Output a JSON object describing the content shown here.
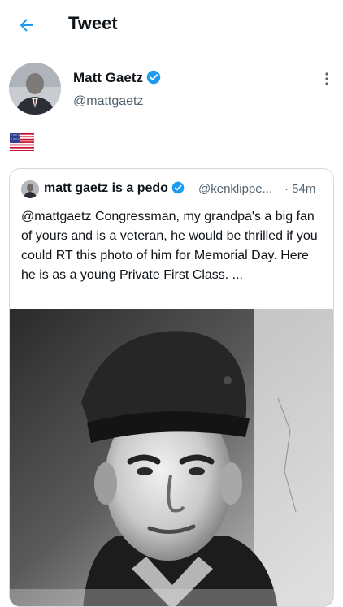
{
  "header": {
    "title": "Tweet"
  },
  "tweet": {
    "author_name": "Matt Gaetz",
    "author_handle": "@mattgaetz",
    "verified": true,
    "flag_icon": "us-flag-icon"
  },
  "quoted_tweet": {
    "author_name": "matt gaetz is a pedo",
    "verified": true,
    "author_handle": "@kenklippe...",
    "time": "· 54m",
    "text": "@mattgaetz Congressman, my grandpa's a big fan of yours and is a veteran, he would be thrilled if you could RT this photo of him for Memorial Day. Here he is as a young Private First Class. ..."
  },
  "colors": {
    "accent": "#1d9bf0",
    "text": "#0f1419",
    "secondary": "#536471"
  }
}
